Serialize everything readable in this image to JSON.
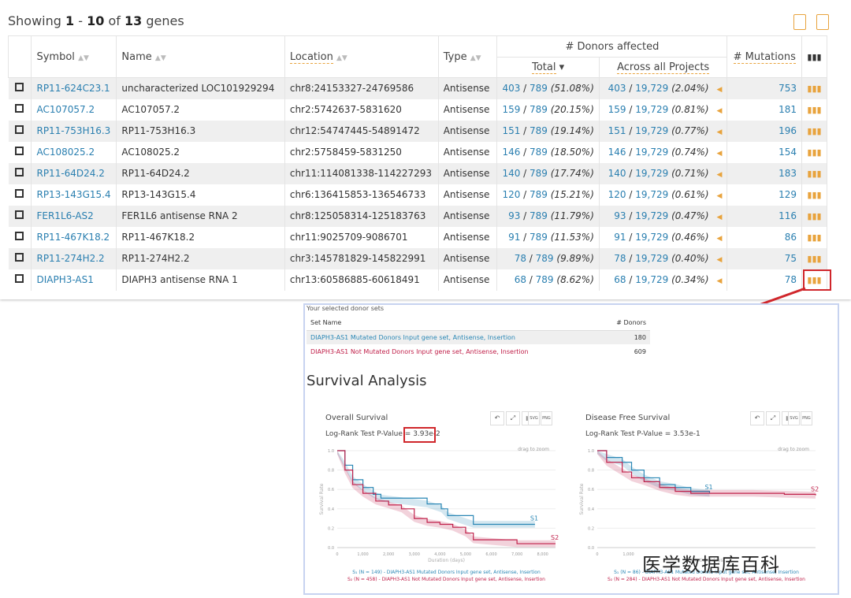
{
  "showing": {
    "prefix": "Showing",
    "from": "1",
    "sep": "-",
    "to": "10",
    "of": "of",
    "total": "13",
    "suffix": "genes"
  },
  "header": {
    "symbol": "Symbol",
    "name": "Name",
    "location": "Location",
    "type": "Type",
    "donors_affected": "# Donors affected",
    "total": "Total",
    "across": "Across all Projects",
    "mutations": "# Mutations"
  },
  "icons": {
    "export": "file-export-icon",
    "tsv": "document-icon",
    "chart": "bar-chart-icon"
  },
  "rows": [
    {
      "symbol": "RP11-624C23.1",
      "name": "uncharacterized LOC101929294",
      "location": "chr8:24153327-24769586",
      "type": "Antisense",
      "t_n": "403",
      "t_d": "789",
      "t_p": "(51.08%)",
      "a_n": "403",
      "a_d": "19,729",
      "a_p": "(2.04%)",
      "mut": "753"
    },
    {
      "symbol": "AC107057.2",
      "name": "AC107057.2",
      "location": "chr2:5742637-5831620",
      "type": "Antisense",
      "t_n": "159",
      "t_d": "789",
      "t_p": "(20.15%)",
      "a_n": "159",
      "a_d": "19,729",
      "a_p": "(0.81%)",
      "mut": "181"
    },
    {
      "symbol": "RP11-753H16.3",
      "name": "RP11-753H16.3",
      "location": "chr12:54747445-54891472",
      "type": "Antisense",
      "t_n": "151",
      "t_d": "789",
      "t_p": "(19.14%)",
      "a_n": "151",
      "a_d": "19,729",
      "a_p": "(0.77%)",
      "mut": "196"
    },
    {
      "symbol": "AC108025.2",
      "name": "AC108025.2",
      "location": "chr2:5758459-5831250",
      "type": "Antisense",
      "t_n": "146",
      "t_d": "789",
      "t_p": "(18.50%)",
      "a_n": "146",
      "a_d": "19,729",
      "a_p": "(0.74%)",
      "mut": "154"
    },
    {
      "symbol": "RP11-64D24.2",
      "name": "RP11-64D24.2",
      "location": "chr11:114081338-114227293",
      "type": "Antisense",
      "t_n": "140",
      "t_d": "789",
      "t_p": "(17.74%)",
      "a_n": "140",
      "a_d": "19,729",
      "a_p": "(0.71%)",
      "mut": "183"
    },
    {
      "symbol": "RP13-143G15.4",
      "name": "RP13-143G15.4",
      "location": "chr6:136415853-136546733",
      "type": "Antisense",
      "t_n": "120",
      "t_d": "789",
      "t_p": "(15.21%)",
      "a_n": "120",
      "a_d": "19,729",
      "a_p": "(0.61%)",
      "mut": "129"
    },
    {
      "symbol": "FER1L6-AS2",
      "name": "FER1L6 antisense RNA 2",
      "location": "chr8:125058314-125183763",
      "type": "Antisense",
      "t_n": "93",
      "t_d": "789",
      "t_p": "(11.79%)",
      "a_n": "93",
      "a_d": "19,729",
      "a_p": "(0.47%)",
      "mut": "116"
    },
    {
      "symbol": "RP11-467K18.2",
      "name": "RP11-467K18.2",
      "location": "chr11:9025709-9086701",
      "type": "Antisense",
      "t_n": "91",
      "t_d": "789",
      "t_p": "(11.53%)",
      "a_n": "91",
      "a_d": "19,729",
      "a_p": "(0.46%)",
      "mut": "86"
    },
    {
      "symbol": "RP11-274H2.2",
      "name": "RP11-274H2.2",
      "location": "chr3:145781829-145822991",
      "type": "Antisense",
      "t_n": "78",
      "t_d": "789",
      "t_p": "(9.89%)",
      "a_n": "78",
      "a_d": "19,729",
      "a_p": "(0.40%)",
      "mut": "75"
    },
    {
      "symbol": "DIAPH3-AS1",
      "name": "DIAPH3 antisense RNA 1",
      "location": "chr13:60586885-60618491",
      "type": "Antisense",
      "t_n": "68",
      "t_d": "789",
      "t_p": "(8.62%)",
      "a_n": "68",
      "a_d": "19,729",
      "a_p": "(0.34%)",
      "mut": "78"
    }
  ],
  "panel": {
    "selected_title": "Your selected donor sets",
    "set_name": "Set Name",
    "donors": "# Donors",
    "sets": [
      {
        "name": "DIAPH3-AS1 Mutated Donors Input gene set, Antisense, Insertion",
        "count": "180"
      },
      {
        "name": "DIAPH3-AS1 Not Mutated Donors Input gene set, Antisense, Insertion",
        "count": "609"
      }
    ],
    "title": "Survival Analysis",
    "toolbar": {
      "svg": "SVG",
      "png": "PNG"
    }
  },
  "colors": {
    "s1": "#2a87b5",
    "s2": "#c0204a",
    "accent": "#e8a33d",
    "link": "#2a7fb0",
    "highlight": "#d0262b"
  },
  "chart_data": [
    {
      "type": "line",
      "title": "Overall Survival",
      "pvalue_label": "Log-Rank Test P-Value = ",
      "pvalue": "3.93e-2",
      "hint": "drag to zoom",
      "xlabel": "Duration (days)",
      "ylabel": "Survival Rate",
      "xlim": [
        0,
        8500
      ],
      "ylim": [
        0,
        1
      ],
      "xticks": [
        "0",
        "1,000",
        "2,000",
        "3,000",
        "4,000",
        "5,000",
        "6,000",
        "7,000",
        "8,000"
      ],
      "yticks": [
        "0.0",
        "0.2",
        "0.4",
        "0.6",
        "0.8",
        "1.0"
      ],
      "series": [
        {
          "name": "S1",
          "legend": "S₁ (N = 149) - DIAPH3-AS1 Mutated Donors Input gene set, Antisense, Insertion",
          "points": [
            [
              0,
              1
            ],
            [
              300,
              0.85
            ],
            [
              600,
              0.7
            ],
            [
              1000,
              0.62
            ],
            [
              1400,
              0.55
            ],
            [
              1700,
              0.51
            ],
            [
              3500,
              0.45
            ],
            [
              4050,
              0.4
            ],
            [
              4300,
              0.33
            ],
            [
              5300,
              0.24
            ],
            [
              7700,
              0.24
            ]
          ]
        },
        {
          "name": "S2",
          "legend": "S₂ (N = 458) - DIAPH3-AS1 Not Mutated Donors Input gene set, Antisense, Insertion",
          "points": [
            [
              0,
              1
            ],
            [
              300,
              0.8
            ],
            [
              600,
              0.65
            ],
            [
              1000,
              0.56
            ],
            [
              1500,
              0.48
            ],
            [
              2000,
              0.44
            ],
            [
              2500,
              0.4
            ],
            [
              3000,
              0.3
            ],
            [
              3500,
              0.26
            ],
            [
              4000,
              0.24
            ],
            [
              4500,
              0.21
            ],
            [
              5000,
              0.15
            ],
            [
              5300,
              0.08
            ],
            [
              7000,
              0.04
            ],
            [
              8500,
              0.04
            ]
          ]
        }
      ]
    },
    {
      "type": "line",
      "title": "Disease Free Survival",
      "pvalue_label": "Log-Rank Test P-Value = ",
      "pvalue": "3.53e-1",
      "hint": "drag to zoom",
      "xlabel": "Duration (days)",
      "ylabel": "Survival Rate",
      "xlim": [
        0,
        7000
      ],
      "ylim": [
        0,
        1
      ],
      "xticks": [
        "0",
        "1,000"
      ],
      "yticks": [
        "0.0",
        "0.2",
        "0.4",
        "0.6",
        "0.8",
        "1.0"
      ],
      "series": [
        {
          "name": "S1",
          "legend": "S₁ (N = 86) - DIAPH3-AS1 Mutated Donors Input gene set, Antisense, Insertion",
          "points": [
            [
              0,
              1
            ],
            [
              300,
              0.93
            ],
            [
              800,
              0.88
            ],
            [
              1100,
              0.8
            ],
            [
              1500,
              0.72
            ],
            [
              2000,
              0.65
            ],
            [
              2500,
              0.62
            ],
            [
              3000,
              0.58
            ],
            [
              3600,
              0.56
            ]
          ]
        },
        {
          "name": "S2",
          "legend": "S₂ (N = 284) - DIAPH3-AS1 Not Mutated Donors Input gene set, Antisense, Insertion",
          "points": [
            [
              0,
              1
            ],
            [
              300,
              0.88
            ],
            [
              800,
              0.78
            ],
            [
              1100,
              0.72
            ],
            [
              1500,
              0.68
            ],
            [
              2000,
              0.62
            ],
            [
              2500,
              0.58
            ],
            [
              3000,
              0.56
            ],
            [
              5000,
              0.56
            ],
            [
              6000,
              0.55
            ],
            [
              7000,
              0.54
            ]
          ]
        }
      ]
    }
  ],
  "watermark": "医学数据库百科"
}
